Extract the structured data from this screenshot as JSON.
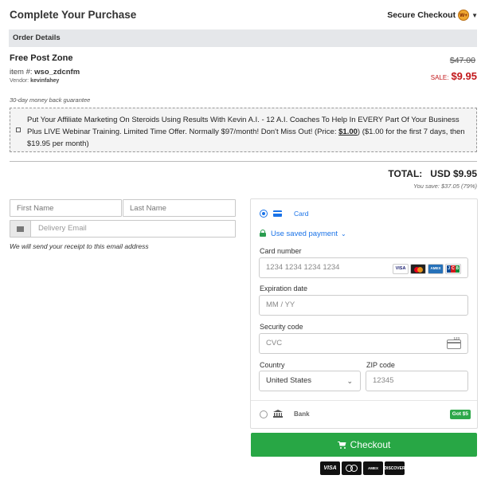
{
  "header": {
    "title": "Complete Your Purchase",
    "secure_label": "Secure Checkout",
    "badge_text": "W+"
  },
  "order": {
    "section_title": "Order Details",
    "product_name": "Free Post Zone",
    "item_prefix": "item #:",
    "item_id": "wso_zdcnfm",
    "vendor_prefix": "Vendor:",
    "vendor": "kevinfahey",
    "original_price": "$47.00",
    "sale_label": "SALE:",
    "sale_price": "$9.95",
    "guarantee": "30-day money back guarantee"
  },
  "upsell": {
    "checked": false,
    "text_before": "Put Your Affiliate Marketing On Steroids Using Results With Kevin A.I. - 12 A.I. Coaches To Help In EVERY Part Of Your Business Plus LIVE Webinar Training. Limited Time Offer. Normally $97/month! Don't Miss Out! (Price: ",
    "price": "$1.00",
    "text_after": ") ($1.00 for the first 7 days, then $19.95 per month)"
  },
  "totals": {
    "total_label": "TOTAL:",
    "total_amount": "USD $9.95",
    "save_text": "You save: $37.05 (79%)"
  },
  "customer": {
    "first_name_placeholder": "First Name",
    "last_name_placeholder": "Last Name",
    "email_placeholder": "Delivery Email",
    "receipt_note": "We will send your receipt to this email address"
  },
  "payment": {
    "card_option_label": "Card",
    "saved_payment_label": "Use saved payment",
    "card_number_label": "Card number",
    "card_number_placeholder": "1234 1234 1234 1234",
    "expiration_label": "Expiration date",
    "expiration_placeholder": "MM / YY",
    "security_label": "Security code",
    "security_placeholder": "CVC",
    "country_label": "Country",
    "country_value": "United States",
    "zip_label": "ZIP code",
    "zip_placeholder": "12345",
    "bank_option_label": "Bank",
    "bank_badge": "Got $5",
    "card_brands": [
      "VISA",
      "mastercard",
      "AMEX",
      "JCB"
    ]
  },
  "checkout": {
    "button_label": "Checkout",
    "logos": [
      "VISA",
      "mastercard",
      "AMERICAN EXPRESS",
      "DISCOVER"
    ]
  },
  "colors": {
    "accent_blue": "#1a73e8",
    "checkout_green": "#28a745",
    "sale_red": "#c2181b",
    "section_bg": "#e5e7ea"
  }
}
